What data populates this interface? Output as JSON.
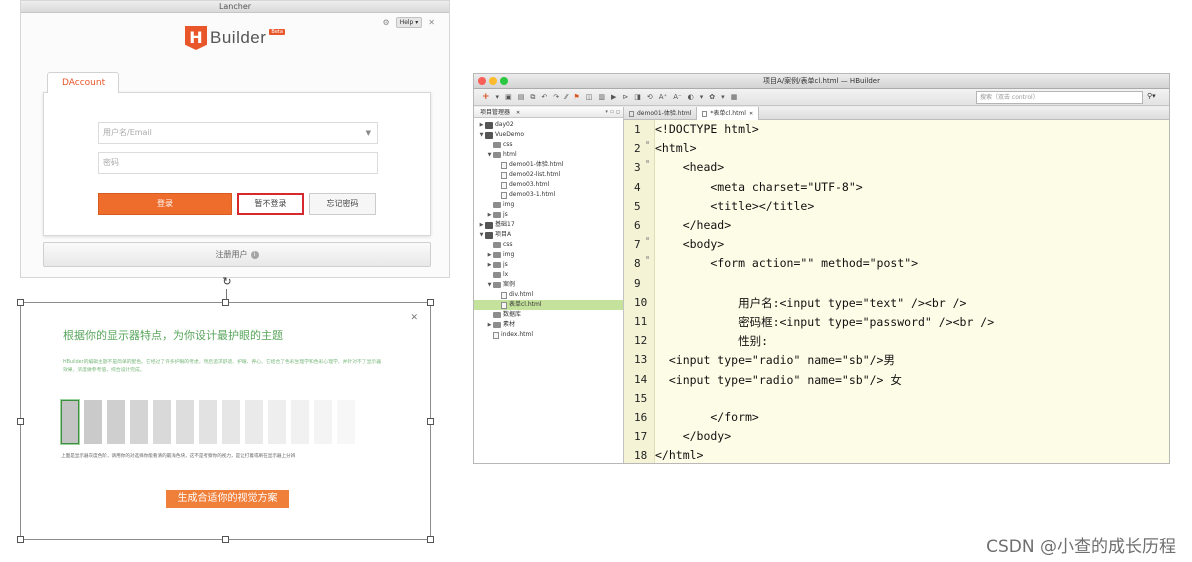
{
  "launcher": {
    "title": "Lancher",
    "help": "Help ▾",
    "logo": {
      "letter": "H",
      "text": "Builder",
      "badge": "Beta"
    },
    "tab_label": "DAccount",
    "username_placeholder": "用户名/Email",
    "password_placeholder": "密码",
    "login_label": "登录",
    "guest_label": "暂不登录",
    "forgot_label": "忘记密码",
    "register_label": "注册用户",
    "accent": "#e8562a"
  },
  "theme_dialog": {
    "title": "根据你的显示器特点，为你设计最护眼的主题",
    "description": "HBuilder的编辑主题不是简单的配色。它经过了许多护眼的考虑，然后追求舒适、护眼、养心。它结合了色彩生理学和色彩心理学，并针对不了显示器效果，浓度做参考值，综合设计完成。",
    "note": "上面是显示器灰度色阶，请用你的对选择你能看清的最浅色块，这不是考察你的视力，是让打着或刷在显示器上分辨",
    "generate_label": "生成合适你的视觉方案",
    "swatches": [
      {
        "color": "#c4c4c4"
      },
      {
        "color": "#cacaca"
      },
      {
        "color": "#cfcfcf"
      },
      {
        "color": "#d4d4d4"
      },
      {
        "color": "#d9d9d9"
      },
      {
        "color": "#dddddd"
      },
      {
        "color": "#e2e2e2"
      },
      {
        "color": "#e6e6e6"
      },
      {
        "color": "#eaeaea"
      },
      {
        "color": "#eeeeee"
      },
      {
        "color": "#f1f1f1"
      },
      {
        "color": "#f4f4f4"
      },
      {
        "color": "#f7f7f7"
      }
    ],
    "selected_swatch_index": 0
  },
  "hbuilder": {
    "title": "项目A/案例/表单cl.html — HBuilder",
    "search_placeholder": "搜索（双击 control）",
    "project_panel_title": "项目管理器",
    "tree": [
      {
        "label": "day02",
        "kind": "proj",
        "depth": 0,
        "arrow": "▶"
      },
      {
        "label": "VueDemo",
        "kind": "proj",
        "depth": 0,
        "arrow": "▼"
      },
      {
        "label": "css",
        "kind": "folder",
        "depth": 1,
        "arrow": ""
      },
      {
        "label": "html",
        "kind": "folder",
        "depth": 1,
        "arrow": "▼"
      },
      {
        "label": "demo01-体验.html",
        "kind": "file",
        "depth": 2,
        "arrow": ""
      },
      {
        "label": "demo02-list.html",
        "kind": "file",
        "depth": 2,
        "arrow": ""
      },
      {
        "label": "demo03.html",
        "kind": "file",
        "depth": 2,
        "arrow": ""
      },
      {
        "label": "demo03-1.html",
        "kind": "file",
        "depth": 2,
        "arrow": ""
      },
      {
        "label": "img",
        "kind": "folder",
        "depth": 1,
        "arrow": ""
      },
      {
        "label": "js",
        "kind": "folder",
        "depth": 1,
        "arrow": "▶"
      },
      {
        "label": "基础17",
        "kind": "proj",
        "depth": 0,
        "arrow": "▶"
      },
      {
        "label": "项目A",
        "kind": "proj",
        "depth": 0,
        "arrow": "▼"
      },
      {
        "label": "css",
        "kind": "folder",
        "depth": 1,
        "arrow": ""
      },
      {
        "label": "img",
        "kind": "folder",
        "depth": 1,
        "arrow": "▶"
      },
      {
        "label": "js",
        "kind": "folder",
        "depth": 1,
        "arrow": "▶"
      },
      {
        "label": "lx",
        "kind": "folder",
        "depth": 1,
        "arrow": ""
      },
      {
        "label": "案例",
        "kind": "folder",
        "depth": 1,
        "arrow": "▼"
      },
      {
        "label": "div.html",
        "kind": "file",
        "depth": 2,
        "arrow": ""
      },
      {
        "label": "表单cl.html",
        "kind": "file",
        "depth": 2,
        "arrow": "",
        "selected": true
      },
      {
        "label": "数据库",
        "kind": "folder",
        "depth": 1,
        "arrow": ""
      },
      {
        "label": "素材",
        "kind": "folder",
        "depth": 1,
        "arrow": "▶"
      },
      {
        "label": "index.html",
        "kind": "file",
        "depth": 1,
        "arrow": ""
      }
    ],
    "editor_tabs": [
      {
        "label": "demo01-体验.html",
        "active": false
      },
      {
        "label": "*表单cl.html",
        "active": true
      }
    ],
    "code_lines": [
      "<!DOCTYPE html>",
      "<html>",
      "    <head>",
      "        <meta charset=\"UTF-8\">",
      "        <title></title>",
      "    </head>",
      "    <body>",
      "        <form action=\"\" method=\"post\">",
      "",
      "            用户名:<input type=\"text\" /><br />",
      "            密码框:<input type=\"password\" /><br />",
      "            性别:",
      "  <input type=\"radio\" name=\"sb\"/>男",
      "  <input type=\"radio\" name=\"sb\"/> 女",
      "",
      "        </form>",
      "    </body>",
      "</html>"
    ],
    "line_numbers": [
      "1",
      "2",
      "3",
      "4",
      "5",
      "6",
      "7",
      "8",
      "9",
      "10",
      "11",
      "12",
      "13",
      "14",
      "15",
      "16",
      "17",
      "18"
    ],
    "foldable_lines": [
      2,
      3,
      7,
      8
    ]
  },
  "watermark": "CSDN @小查的成长历程"
}
